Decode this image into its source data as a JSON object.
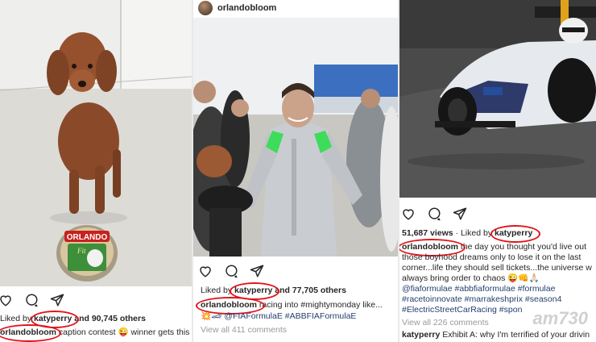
{
  "panel1": {
    "can_label": "ORLANDO",
    "can_sub": "Fit",
    "liked_prefix": "Liked by ",
    "liked_user": "katyperry",
    "liked_suffix": " and 90,745 others",
    "caption_user": "orlandobloom",
    "caption_text": " caption contest 😜 winner gets this"
  },
  "panel2": {
    "username": "orlandobloom",
    "liked_prefix": "Liked by ",
    "liked_user": "katyperry",
    "liked_suffix": " and 77,705 others",
    "caption_user": "orlandobloom",
    "caption_text": " racing into #mightymonday like...",
    "caption_line2": "💥🏎 @FIAFormulaE #ABBFIAFormulaE",
    "view_comments": "View all 411 comments"
  },
  "panel3": {
    "likes": "51,687 views",
    "liked_prefix": " · Liked by ",
    "liked_user": "katyperry",
    "caption_user": "orlandobloom",
    "caption_lines": [
      " the day you thought you'd live out",
      "those boyhood dreams only to lose it on the last",
      "corner...life they should sell tickets...the universe w",
      "always bring order to chaos 😜👊🙏🏻",
      "@fiaformulae #abbfiaformulae #formulae",
      "#racetoinnovate #marrakeshprix #season4",
      "#ElectricStreetCarRacing #spon"
    ],
    "view_comments": "View all 226 comments",
    "comment_user": "katyperry",
    "comment_text": " Exhibit A: why I'm terrified of your drivin"
  },
  "watermark": "am730",
  "colors": {
    "circle": "#e0141b",
    "tag": "#233e6e",
    "muted": "#999999",
    "suit_green": "#3ddc5a"
  },
  "icons": [
    "heart-icon",
    "comment-icon",
    "share-icon"
  ]
}
